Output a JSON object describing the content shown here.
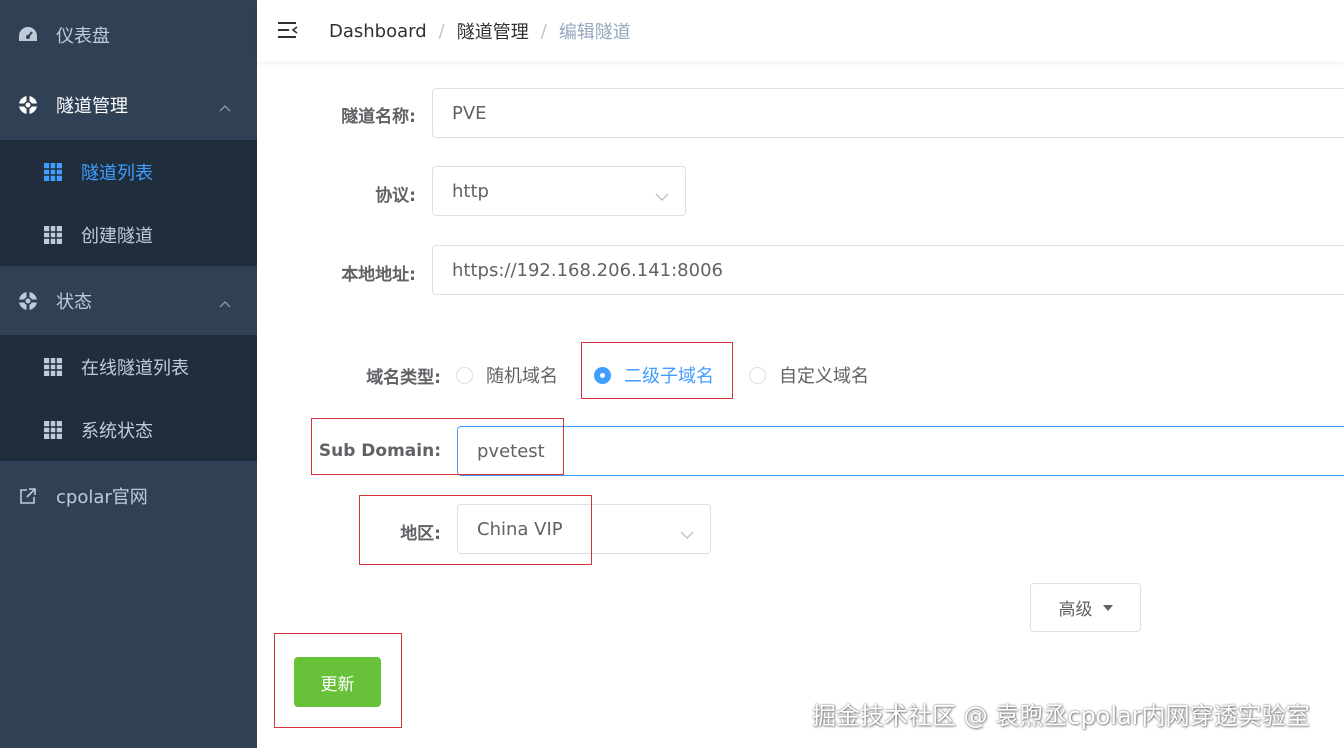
{
  "sidebar": {
    "dashboard": {
      "label": "仪表盘",
      "icon": "dashboard-icon"
    },
    "tunnel_mgmt": {
      "label": "隧道管理",
      "icon": "lifebuoy-icon",
      "children": [
        {
          "label": "隧道列表",
          "icon": "table-icon",
          "active": true
        },
        {
          "label": "创建隧道",
          "icon": "table-icon"
        }
      ]
    },
    "status": {
      "label": "状态",
      "icon": "lifebuoy-icon",
      "children": [
        {
          "label": "在线隧道列表",
          "icon": "table-icon"
        },
        {
          "label": "系统状态",
          "icon": "table-icon"
        }
      ]
    },
    "external": {
      "label": "cpolar官网",
      "icon": "external-link-icon"
    }
  },
  "header": {
    "breadcrumb": [
      "Dashboard",
      "隧道管理",
      "编辑隧道"
    ],
    "separator": "/"
  },
  "form": {
    "tunnel_name": {
      "label": "隧道名称:",
      "value": "PVE"
    },
    "protocol": {
      "label": "协议:",
      "value": "http"
    },
    "local_address": {
      "label": "本地地址:",
      "value": "https://192.168.206.141:8006"
    },
    "domain_type": {
      "label": "域名类型:",
      "options": [
        "随机域名",
        "二级子域名",
        "自定义域名"
      ],
      "selected": "二级子域名"
    },
    "sub_domain": {
      "label": "Sub Domain:",
      "value": "pvetest"
    },
    "region": {
      "label": "地区:",
      "value": "China VIP"
    },
    "advanced_button": "高级",
    "update_button": "更新"
  },
  "watermark": "掘金技术社区 @ 袁煦丞cpolar内网穿透实验室",
  "colors": {
    "sidebar_bg": "#304156",
    "submenu_bg": "#1f2d3d",
    "accent": "#409eff",
    "success": "#67c23a",
    "annotation_red": "#d9323a"
  }
}
